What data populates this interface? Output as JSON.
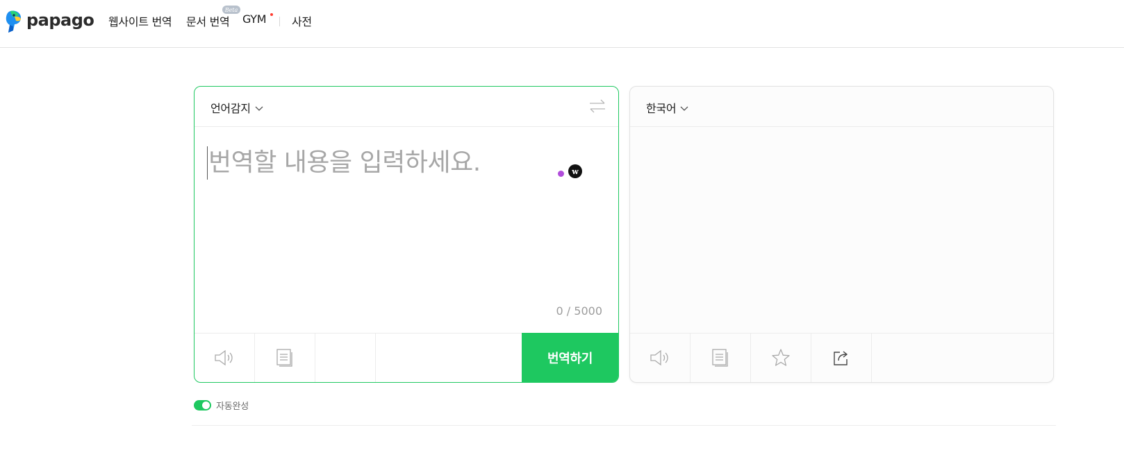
{
  "header": {
    "logo_text": "papago",
    "nav": [
      {
        "label": "웹사이트 번역"
      },
      {
        "label": "문서 번역"
      },
      {
        "label": "GYM"
      },
      {
        "label": "사전"
      }
    ],
    "beta_badge": "Beta"
  },
  "source_panel": {
    "language": "언어감지",
    "placeholder": "번역할 내용을 입력하세요.",
    "char_count": "0 / 5000",
    "translate_button": "번역하기",
    "icons": [
      "speaker-icon",
      "handwriting-icon",
      "swap-icon"
    ],
    "badge_letter": "w"
  },
  "target_panel": {
    "language": "한국어",
    "icons": [
      "speaker-icon",
      "copy-icon",
      "star-icon",
      "share-icon"
    ]
  },
  "autocomplete": {
    "label": "자동완성",
    "enabled": true
  },
  "colors": {
    "accent": "#1ec860",
    "nav_dot": "#ff3b30",
    "purple_dot": "#b14ddb"
  }
}
